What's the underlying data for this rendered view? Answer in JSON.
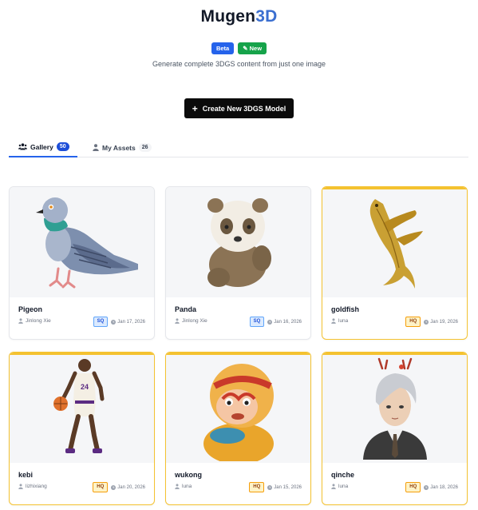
{
  "header": {
    "title_part1": "Mugen",
    "title_part2": "3D",
    "badge_beta": "Beta",
    "badge_new": "New",
    "subtitle": "Generate complete 3DGS content from just one image"
  },
  "create_button": {
    "label": "Create New 3DGS Model",
    "icon": "plus-icon"
  },
  "tabs": [
    {
      "label": "Gallery",
      "count": "50",
      "icon": "users-icon",
      "active": true
    },
    {
      "label": "My Assets",
      "count": "26",
      "icon": "user-icon",
      "active": false
    }
  ],
  "models": [
    {
      "name": "Pigeon",
      "author": "Jinlong Xie",
      "quality": "SQ",
      "date": "Jan 17, 2026",
      "image": "pigeon-image"
    },
    {
      "name": "Panda",
      "author": "Jinlong Xie",
      "quality": "SQ",
      "date": "Jan 16, 2026",
      "image": "panda-image"
    },
    {
      "name": "goldfish",
      "author": "luna",
      "quality": "HQ",
      "date": "Jan 19, 2026",
      "image": "goldfish-image"
    },
    {
      "name": "kebi",
      "author": "lizhixiang",
      "quality": "HQ",
      "date": "Jan 20, 2026",
      "image": "basketball-player-image"
    },
    {
      "name": "wukong",
      "author": "luna",
      "quality": "HQ",
      "date": "Jan 15, 2026",
      "image": "monkey-king-image"
    },
    {
      "name": "qinche",
      "author": "luna",
      "quality": "HQ",
      "date": "Jan 18, 2026",
      "image": "character-portrait-image"
    }
  ],
  "colors": {
    "accent": "#2563eb",
    "new_badge": "#16a34a",
    "hq_border": "#f4c230",
    "button_bg": "#0b0b0b"
  }
}
